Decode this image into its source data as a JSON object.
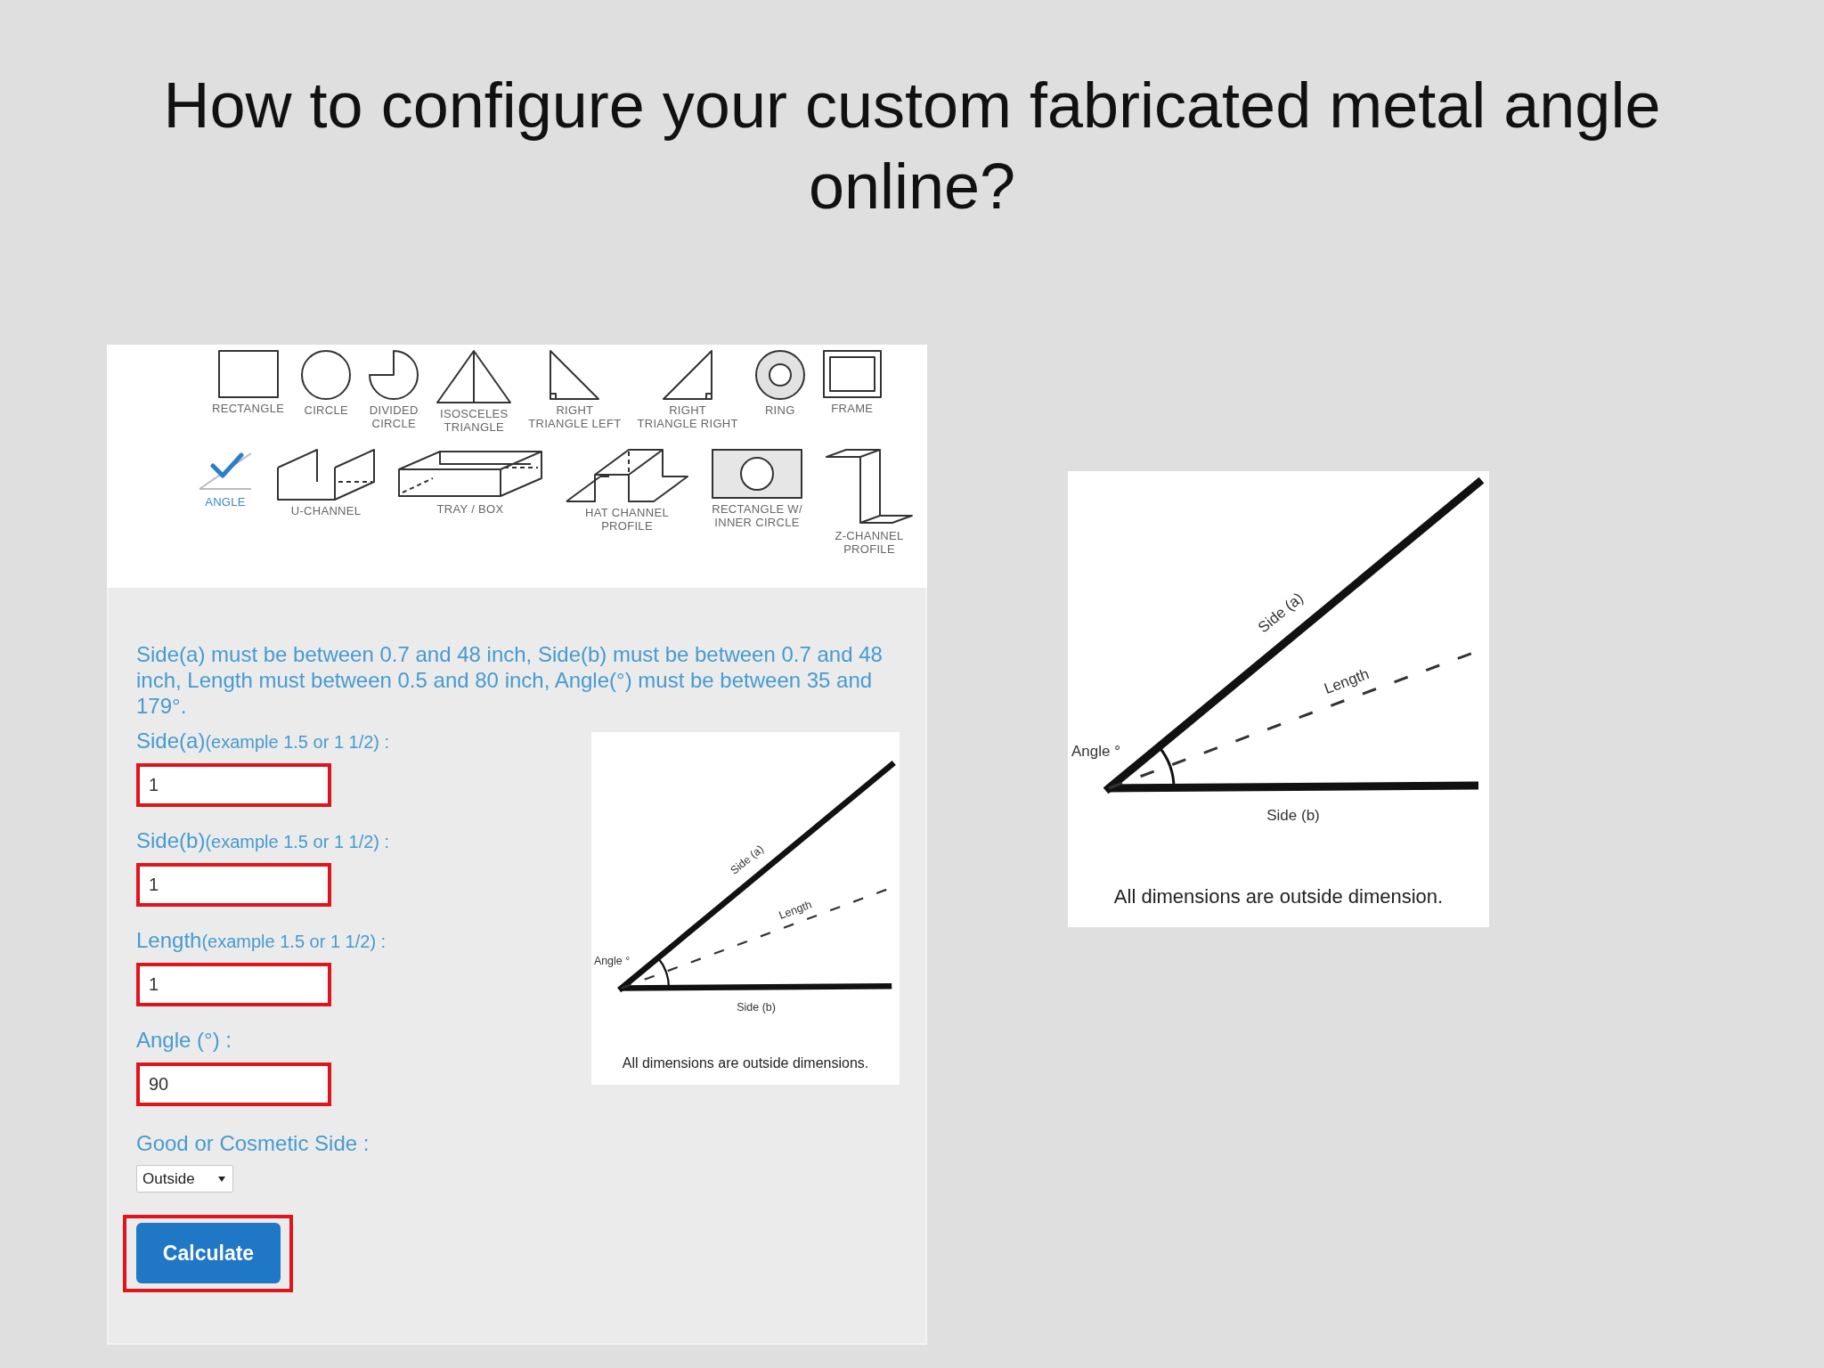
{
  "title": "How to configure your custom fabricated metal angle online?",
  "shape_picker": {
    "rows": [
      {
        "items": [
          {
            "kind": "rectangle",
            "label": "RECTANGLE",
            "selected": false
          },
          {
            "kind": "circle",
            "label": "CIRCLE",
            "selected": false
          },
          {
            "kind": "pie",
            "label": "DIVIDED\nCIRCLE",
            "selected": false
          },
          {
            "kind": "isosceles",
            "label": "ISOSCELES\nTRIANGLE",
            "selected": false
          },
          {
            "kind": "rightleft",
            "label": "RIGHT\nTRIANGLE LEFT",
            "selected": false
          },
          {
            "kind": "rightright",
            "label": "RIGHT\nTRIANGLE RIGHT",
            "selected": false
          },
          {
            "kind": "ring",
            "label": "RING",
            "selected": false
          },
          {
            "kind": "frame",
            "label": "FRAME",
            "selected": false
          }
        ]
      },
      {
        "items": [
          {
            "kind": "angle",
            "label": "ANGLE",
            "selected": true
          },
          {
            "kind": "uchannel",
            "label": "U-CHANNEL",
            "selected": false
          },
          {
            "kind": "tray",
            "label": "TRAY / BOX",
            "selected": false
          },
          {
            "kind": "hat",
            "label": "HAT CHANNEL\nPROFILE",
            "selected": false
          },
          {
            "kind": "holed",
            "label": "RECTANGLE W/\nINNER CIRCLE",
            "selected": false
          },
          {
            "kind": "zchannel",
            "label": "Z-CHANNEL\nPROFILE",
            "selected": false
          }
        ]
      }
    ]
  },
  "form": {
    "notice": "Side(a) must be between 0.7 and 48 inch, Side(b) must be between 0.7 and 48 inch, Length must between 0.5 and 80 inch, Angle(°) must be between 35 and 179°.",
    "fields": [
      {
        "label": "Side(a)",
        "hint": "(example 1.5 or 1 1/2) :",
        "value": "1",
        "highlighted": true
      },
      {
        "label": "Side(b)",
        "hint": "(example 1.5 or 1 1/2) :",
        "value": "1",
        "highlighted": true
      },
      {
        "label": "Length",
        "hint": "(example 1.5 or 1 1/2) :",
        "value": "1",
        "highlighted": true
      },
      {
        "label": "Angle (°) :",
        "value": "90",
        "highlighted": true
      }
    ],
    "side_select": {
      "label": "Good or Cosmetic Side :",
      "value": "Outside"
    },
    "calculate_button": {
      "label": "Calculate",
      "highlighted": true
    },
    "diagram": {
      "side_a_label": "Side (a)",
      "length_label": "Length",
      "angle_label": "Angle °",
      "side_b_label": "Side (b)",
      "caption": "All dimensions are outside dimensions."
    }
  },
  "diagram": {
    "side_a_label": "Side (a)",
    "length_label": "Length",
    "angle_label": "Angle °",
    "side_b_label": "Side (b)",
    "caption": "All dimensions are outside dimension."
  }
}
